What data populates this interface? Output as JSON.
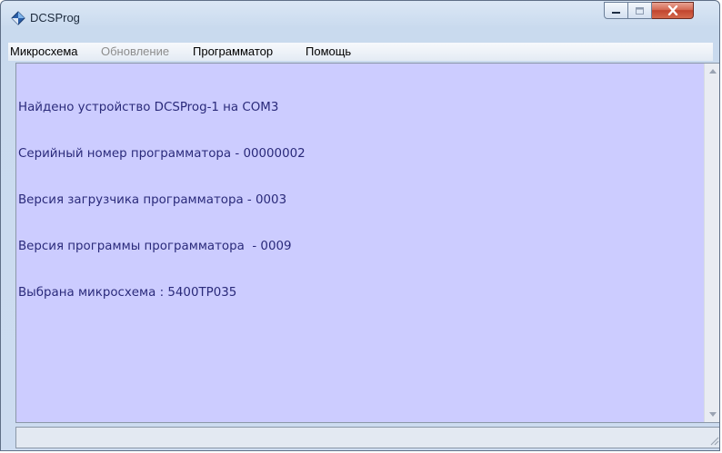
{
  "window": {
    "title": "DCSProg"
  },
  "menu": {
    "items": [
      {
        "label": "Микросхема",
        "enabled": true
      },
      {
        "label": "Обновление",
        "enabled": false
      },
      {
        "label": "Программатор",
        "enabled": true
      },
      {
        "label": "Помощь",
        "enabled": true
      }
    ]
  },
  "log": {
    "lines": [
      "Найдено устройство DCSProg-1 на COM3",
      "Серийный номер программатора - 00000002",
      "Версия загрузчика программатора - 0003",
      "Версия программы программатора  - 0009",
      "Выбрана микросхема : 5400ТР035"
    ],
    "background": "#ccccff",
    "text_color": "#2a2a7a"
  },
  "icons": {
    "app": "diamond-app-icon",
    "minimize": "minimize-icon",
    "maximize": "maximize-icon",
    "close": "close-icon",
    "scroll_up": "scroll-up-arrow-icon",
    "scroll_down": "scroll-down-arrow-icon",
    "resize": "resize-grip-icon"
  },
  "status": {
    "text": ""
  }
}
